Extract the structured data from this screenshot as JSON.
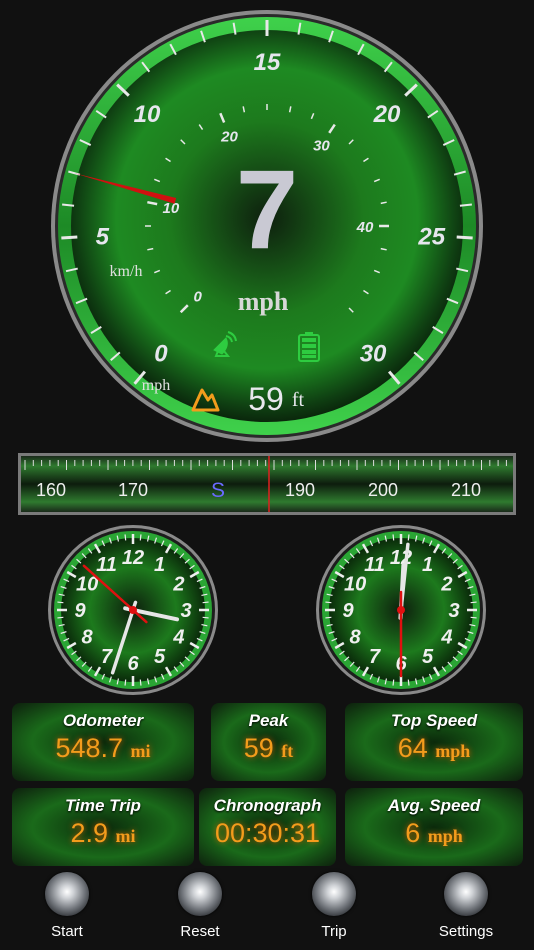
{
  "speedometer": {
    "speed_value": "7",
    "speed_unit": "mph",
    "outer_unit": "mph",
    "inner_unit": "km/h",
    "mph_ticks": [
      "0",
      "5",
      "10",
      "15",
      "20",
      "25",
      "30"
    ],
    "kmh_ticks": [
      "0",
      "10",
      "20",
      "30",
      "40"
    ],
    "altitude_value": "59",
    "altitude_unit": "ft",
    "mph_needle_value": 7,
    "colors": {
      "accent": "#2ecc40",
      "needle": "#d01010",
      "altitude_icon": "#f39c1c",
      "battery_icon": "#2ecc40",
      "satellite_icon": "#2ecc40"
    }
  },
  "compass": {
    "labels": [
      "160",
      "170",
      "S",
      "190",
      "200",
      "210"
    ],
    "heading_label": "S"
  },
  "clocks": {
    "clock1": {
      "numerals": [
        "12",
        "1",
        "2",
        "3",
        "4",
        "5",
        "6",
        "7",
        "8",
        "9",
        "10",
        "11"
      ],
      "hour": 3.4,
      "minute": 33,
      "second": 52
    },
    "clock2": {
      "numerals": [
        "12",
        "1",
        "2",
        "3",
        "4",
        "5",
        "6",
        "7",
        "8",
        "9",
        "10",
        "11"
      ],
      "hour": 0.1,
      "minute": 1,
      "second": 30
    }
  },
  "stats": {
    "odometer": {
      "label": "Odometer",
      "value": "548.7",
      "unit": "mi"
    },
    "peak": {
      "label": "Peak",
      "value": "59",
      "unit": "ft"
    },
    "top_speed": {
      "label": "Top Speed",
      "value": "64",
      "unit": "mph"
    },
    "time_trip": {
      "label": "Time Trip",
      "value": "2.9",
      "unit": "mi"
    },
    "chronograph": {
      "label": "Chronograph",
      "value": "00:30:31"
    },
    "avg_speed": {
      "label": "Avg. Speed",
      "value": "6",
      "unit": "mph"
    }
  },
  "buttons": {
    "start": "Start",
    "reset": "Reset",
    "trip": "Trip",
    "settings": "Settings"
  }
}
